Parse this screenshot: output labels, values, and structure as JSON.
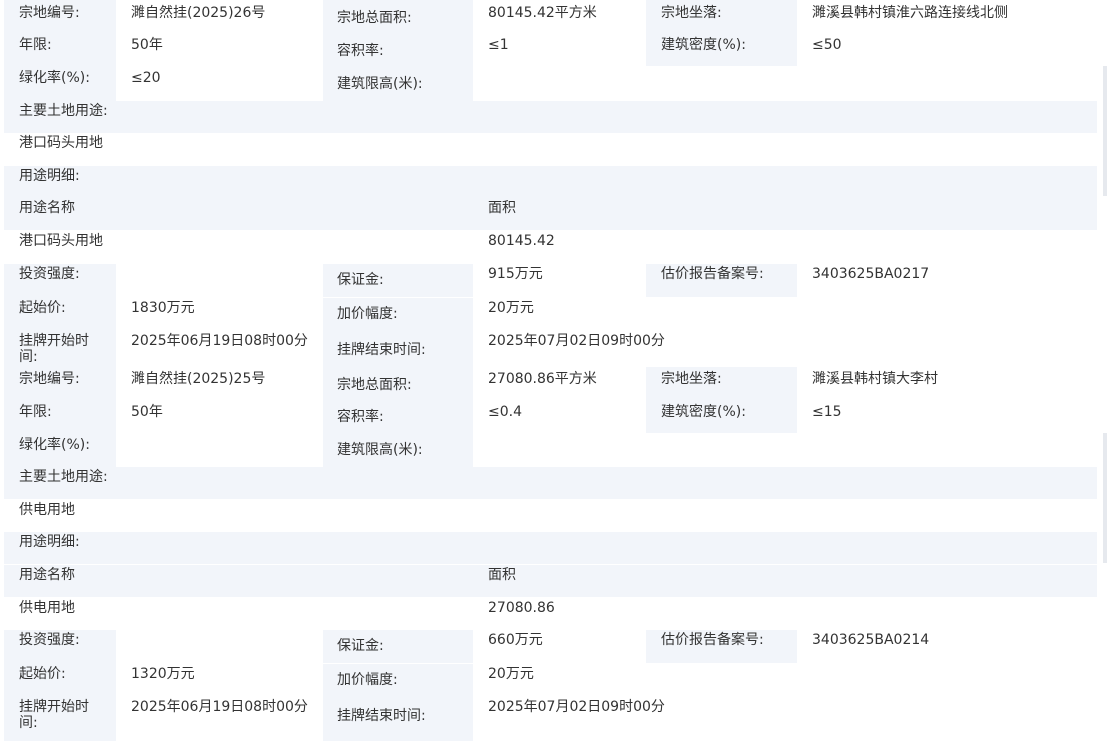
{
  "parcels": [
    {
      "parcel_no_label": "宗地编号:",
      "parcel_no": "濉自然挂(2025)26号",
      "total_area_label": "宗地总面积:",
      "total_area": "80145.42平方米",
      "location_label": "宗地坐落:",
      "location": "濉溪县韩村镇淮六路连接线北侧",
      "term_label": "年限:",
      "term": "50年",
      "far_label": "容积率:",
      "far": "≤1",
      "density_label": "建筑密度(%):",
      "density": "≤50",
      "green_label": "绿化率(%):",
      "green": "≤20",
      "height_label": "建筑限高(米):",
      "height": "",
      "main_use_label": "主要土地用途:",
      "main_use": "港口码头用地",
      "use_detail_label": "用途明细:",
      "use_name_header": "用途名称",
      "area_header": "面积",
      "use_rows": [
        {
          "name": "港口码头用地",
          "area": "80145.42"
        }
      ],
      "invest_label": "投资强度:",
      "invest": "",
      "deposit_label": "保证金:",
      "deposit": "915万元",
      "appraisal_label": "估价报告备案号:",
      "appraisal": "3403625BA0217",
      "start_price_label": "起始价:",
      "start_price": "1830万元",
      "increment_label": "加价幅度:",
      "increment": "20万元",
      "listing_start_label_1": "挂牌开始时",
      "listing_start_label_2": "间:",
      "listing_start": "2025年06月19日08时00分",
      "listing_end_label": "挂牌结束时间:",
      "listing_end": "2025年07月02日09时00分"
    },
    {
      "parcel_no_label": "宗地编号:",
      "parcel_no": "濉自然挂(2025)25号",
      "total_area_label": "宗地总面积:",
      "total_area": "27080.86平方米",
      "location_label": "宗地坐落:",
      "location": "濉溪县韩村镇大李村",
      "term_label": "年限:",
      "term": "50年",
      "far_label": "容积率:",
      "far": "≤0.4",
      "density_label": "建筑密度(%):",
      "density": "≤15",
      "green_label": "绿化率(%):",
      "green": "",
      "height_label": "建筑限高(米):",
      "height": "",
      "main_use_label": "主要土地用途:",
      "main_use": "供电用地",
      "use_detail_label": "用途明细:",
      "use_name_header": "用途名称",
      "area_header": "面积",
      "use_rows": [
        {
          "name": "供电用地",
          "area": "27080.86"
        }
      ],
      "invest_label": "投资强度:",
      "invest": "",
      "deposit_label": "保证金:",
      "deposit": "660万元",
      "appraisal_label": "估价报告备案号:",
      "appraisal": "3403625BA0214",
      "start_price_label": "起始价:",
      "start_price": "1320万元",
      "increment_label": "加价幅度:",
      "increment": "20万元",
      "listing_start_label_1": "挂牌开始时",
      "listing_start_label_2": "间:",
      "listing_start": "2025年06月19日08时00分",
      "listing_end_label": "挂牌结束时间:",
      "listing_end": "2025年07月02日09时00分"
    }
  ]
}
